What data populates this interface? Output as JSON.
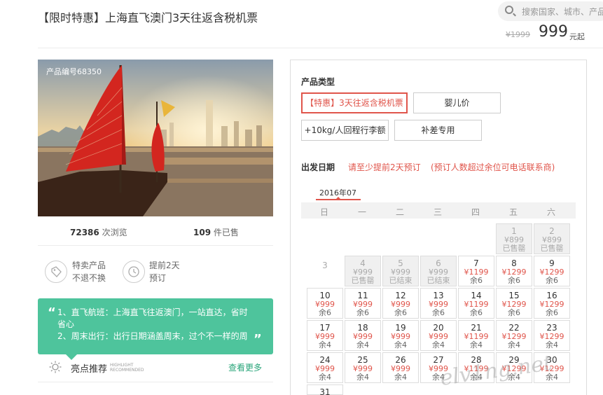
{
  "header": {
    "title": "【限时特惠】上海直飞澳门3天往返含税机票",
    "search_placeholder": "搜索国家、城市、产品",
    "old_price": "¥1999",
    "price": "999",
    "price_unit": "元起"
  },
  "product": {
    "product_no": "产品编号68350",
    "views_count": "72386",
    "views_label": "次浏览",
    "sold_count": "109",
    "sold_label": "件已售",
    "features": [
      {
        "line1": "特卖产品",
        "line2": "不退不换"
      },
      {
        "line1": "提前2天",
        "line2": "预订"
      }
    ],
    "highlights": [
      "1、直飞航班：上海直飞往返澳门，一站直达，省时省心",
      "2、周末出行：出行日期涵盖周末，过个不一样的周末"
    ],
    "highlight_title": "亮点推荐",
    "highlight_en_1": "HIGHLIGHT",
    "highlight_en_2": "RECOMMENDED",
    "see_more": "查看更多"
  },
  "booking": {
    "type_label": "产品类型",
    "options": [
      "【特惠】3天往返含税机票",
      "婴儿价",
      "+10kg/人回程行李额",
      "补差专用"
    ],
    "date_label": "出发日期",
    "date_hint_1": "请至少提前2天预订",
    "date_hint_2": "(预订人数超过余位可电话联系商)",
    "month": "2016年07",
    "weekdays": [
      "日",
      "一",
      "二",
      "三",
      "四",
      "五",
      "六"
    ],
    "days": [
      {
        "d": "1",
        "p": "¥899",
        "s": "已售罄"
      },
      {
        "d": "2",
        "p": "¥899",
        "s": "已售罄"
      },
      {
        "d": "3",
        "p": "",
        "s": ""
      },
      {
        "d": "4",
        "p": "¥999",
        "s": "已售罄"
      },
      {
        "d": "5",
        "p": "¥999",
        "s": "已结束"
      },
      {
        "d": "6",
        "p": "¥999",
        "s": "已结束"
      },
      {
        "d": "7",
        "p": "¥1199",
        "s": "余6"
      },
      {
        "d": "8",
        "p": "¥1299",
        "s": "余6"
      },
      {
        "d": "9",
        "p": "¥1299",
        "s": "余6"
      },
      {
        "d": "10",
        "p": "¥999",
        "s": "余6"
      },
      {
        "d": "11",
        "p": "¥999",
        "s": "余6"
      },
      {
        "d": "12",
        "p": "¥999",
        "s": "余6"
      },
      {
        "d": "13",
        "p": "¥999",
        "s": "余6"
      },
      {
        "d": "14",
        "p": "¥1199",
        "s": "余6"
      },
      {
        "d": "15",
        "p": "¥1299",
        "s": "余6"
      },
      {
        "d": "16",
        "p": "¥1299",
        "s": "余6"
      },
      {
        "d": "17",
        "p": "¥999",
        "s": "余4"
      },
      {
        "d": "18",
        "p": "¥999",
        "s": "余4"
      },
      {
        "d": "19",
        "p": "¥999",
        "s": "余4"
      },
      {
        "d": "20",
        "p": "¥999",
        "s": "余4"
      },
      {
        "d": "21",
        "p": "¥1199",
        "s": "余4"
      },
      {
        "d": "22",
        "p": "¥1299",
        "s": "余4"
      },
      {
        "d": "23",
        "p": "¥1299",
        "s": "余4"
      },
      {
        "d": "24",
        "p": "¥999",
        "s": "余4"
      },
      {
        "d": "25",
        "p": "¥999",
        "s": "余4"
      },
      {
        "d": "26",
        "p": "¥999",
        "s": "余4"
      },
      {
        "d": "27",
        "p": "¥999",
        "s": "余4"
      },
      {
        "d": "28",
        "p": "¥1199",
        "s": "余4"
      },
      {
        "d": "29",
        "p": "¥1299",
        "s": "余4"
      },
      {
        "d": "30",
        "p": "¥1299",
        "s": "余4"
      },
      {
        "d": "31",
        "p": "",
        "s": ""
      }
    ]
  },
  "watermark": "elv1ng.net",
  "colors": {
    "accent_red": "#e0554b",
    "green": "#4ec49c"
  }
}
